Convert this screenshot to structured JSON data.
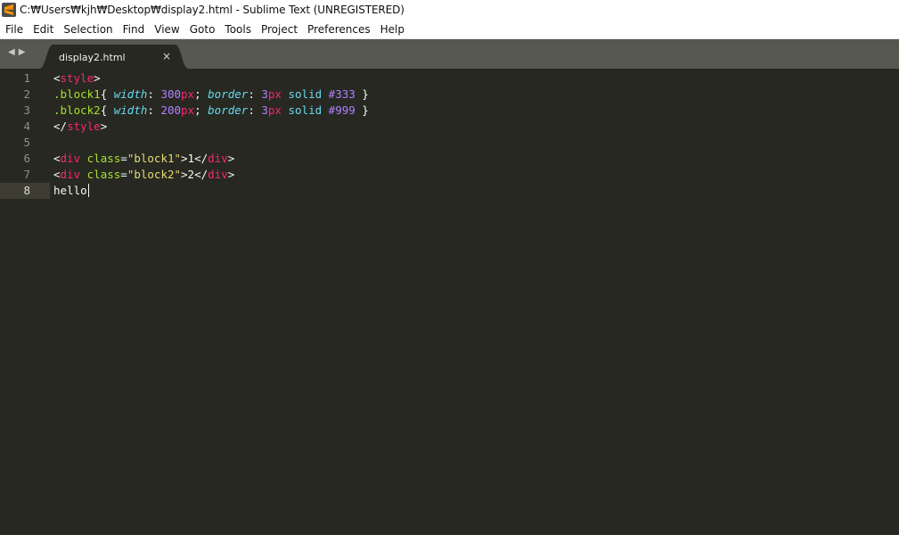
{
  "window": {
    "title": "C:₩Users₩kjh₩Desktop₩display2.html - Sublime Text (UNREGISTERED)"
  },
  "menu": [
    "File",
    "Edit",
    "Selection",
    "Find",
    "View",
    "Goto",
    "Tools",
    "Project",
    "Preferences",
    "Help"
  ],
  "tab": {
    "label": "display2.html",
    "close": "×"
  },
  "editor": {
    "line_numbers": [
      "1",
      "2",
      "3",
      "4",
      "5",
      "6",
      "7",
      "8"
    ],
    "active_line": "8",
    "lines": [
      {
        "tokens": [
          [
            "<",
            "pun"
          ],
          [
            "style",
            "tag"
          ],
          [
            ">",
            "pun"
          ]
        ]
      },
      {
        "tokens": [
          [
            ".block1",
            "sel"
          ],
          [
            "{ ",
            "pun"
          ],
          [
            "width",
            "prop"
          ],
          [
            ": ",
            "pun"
          ],
          [
            "300",
            "num"
          ],
          [
            "px",
            "unit"
          ],
          [
            "; ",
            "pun"
          ],
          [
            "border",
            "prop"
          ],
          [
            ": ",
            "pun"
          ],
          [
            "3",
            "num"
          ],
          [
            "px",
            "unit"
          ],
          [
            " ",
            "pun"
          ],
          [
            "solid",
            "kw"
          ],
          [
            " ",
            "pun"
          ],
          [
            "#333",
            "num"
          ],
          [
            " }",
            "pun"
          ]
        ]
      },
      {
        "tokens": [
          [
            ".block2",
            "sel"
          ],
          [
            "{ ",
            "pun"
          ],
          [
            "width",
            "prop"
          ],
          [
            ": ",
            "pun"
          ],
          [
            "200",
            "num"
          ],
          [
            "px",
            "unit"
          ],
          [
            "; ",
            "pun"
          ],
          [
            "border",
            "prop"
          ],
          [
            ": ",
            "pun"
          ],
          [
            "3",
            "num"
          ],
          [
            "px",
            "unit"
          ],
          [
            " ",
            "pun"
          ],
          [
            "solid",
            "kw"
          ],
          [
            " ",
            "pun"
          ],
          [
            "#999",
            "num"
          ],
          [
            " }",
            "pun"
          ]
        ]
      },
      {
        "tokens": [
          [
            "</",
            "pun"
          ],
          [
            "style",
            "tag"
          ],
          [
            ">",
            "pun"
          ]
        ]
      },
      {
        "tokens": []
      },
      {
        "tokens": [
          [
            "<",
            "pun"
          ],
          [
            "div",
            "tag"
          ],
          [
            " ",
            "pun"
          ],
          [
            "class",
            "attr"
          ],
          [
            "=",
            "pun"
          ],
          [
            "\"block1\"",
            "str"
          ],
          [
            ">1</",
            "pun"
          ],
          [
            "div",
            "tag"
          ],
          [
            ">",
            "pun"
          ]
        ]
      },
      {
        "tokens": [
          [
            "<",
            "pun"
          ],
          [
            "div",
            "tag"
          ],
          [
            " ",
            "pun"
          ],
          [
            "class",
            "attr"
          ],
          [
            "=",
            "pun"
          ],
          [
            "\"block2\"",
            "str"
          ],
          [
            ">2</",
            "pun"
          ],
          [
            "div",
            "tag"
          ],
          [
            ">",
            "pun"
          ]
        ]
      },
      {
        "tokens": [
          [
            "hello",
            "txt"
          ]
        ],
        "cursor": true
      }
    ]
  },
  "icons": {
    "app": "sublime-text-logo-icon",
    "tab_prev": "chevron-left-icon",
    "tab_next": "chevron-right-icon",
    "tab_close": "close-icon"
  },
  "colors": {
    "editor_bg": "#272822",
    "tab_bar_bg": "#57584f",
    "active_tab_bg": "#272822",
    "line_highlight": "#3e3d32"
  }
}
